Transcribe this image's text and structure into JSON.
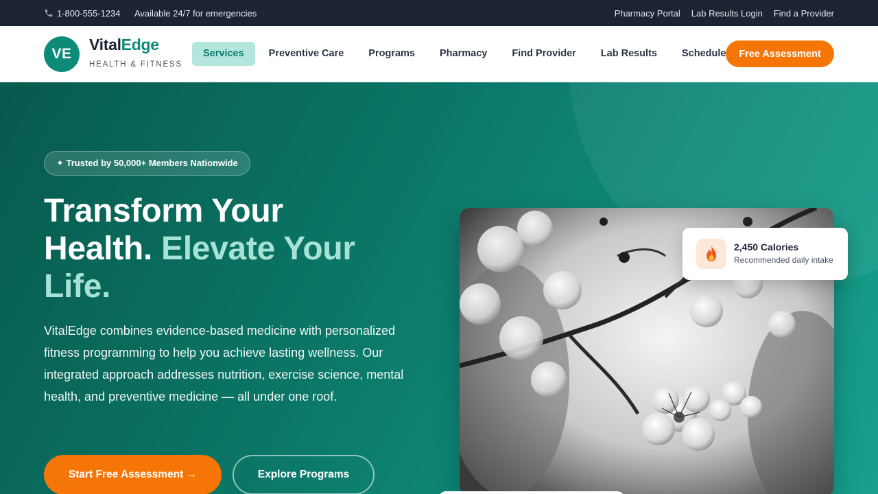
{
  "topbar": {
    "phone": "1-800-555-1234",
    "availability": "Available 24/7 for emergencies",
    "links": [
      "Pharmacy Portal",
      "Lab Results Login",
      "Find a Provider"
    ]
  },
  "brand": {
    "initials": "VE",
    "name_part1": "Vital",
    "name_part2": "Edge",
    "tagline": "HEALTH & FITNESS",
    "accent_color": "#0d8a78"
  },
  "nav": {
    "items": [
      "Services",
      "Preventive Care",
      "Programs",
      "Pharmacy",
      "Find Provider",
      "Lab Results",
      "Schedule"
    ],
    "active": "Services",
    "cta": "Free Assessment",
    "cta_color": "#f57607"
  },
  "hero": {
    "badge": "✦ Trusted by 50,000+ Members Nationwide",
    "headline_line1": "Transform Your",
    "headline_line2_a": "Health.",
    "headline_line2_b": "Elevate Your",
    "headline_line3": "Life.",
    "description": "VitalEdge combines evidence-based medicine with personalized fitness programming to help you achieve lasting wellness. Our integrated approach addresses nutrition, exercise science, mental health, and preventive medicine — all under one roof.",
    "primary_button": "Start Free Assessment →",
    "secondary_button": "Explore Programs"
  },
  "stat_card": {
    "icon": "fire-icon",
    "value": "2,450 Calories",
    "label": "Recommended daily intake"
  },
  "photo": {
    "subject": "black-and-white blossom branch photo"
  }
}
